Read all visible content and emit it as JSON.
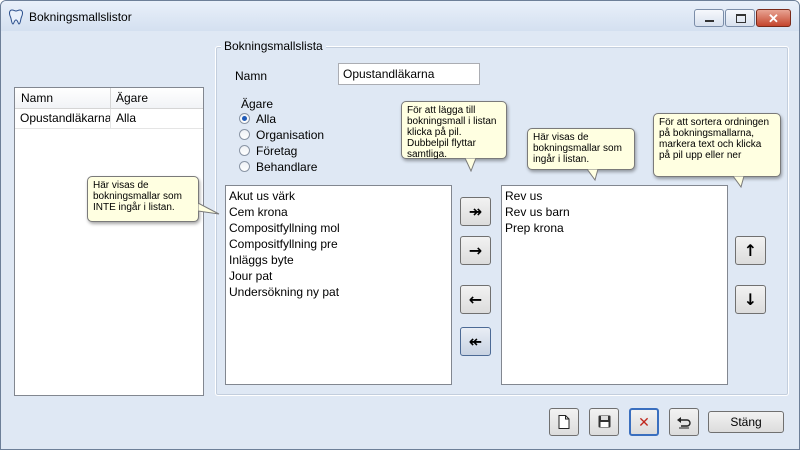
{
  "window": {
    "title": "Bokningsmallslistor",
    "icon": "tooth-icon",
    "controls": {
      "minimize": "minimize-icon",
      "maximize": "maximize-icon",
      "close": "✕"
    }
  },
  "grid": {
    "columns": [
      "Namn",
      "Ägare"
    ],
    "rows": [
      {
        "name": "Opustandläkarna",
        "owner": "Alla"
      }
    ]
  },
  "group": {
    "title": "Bokningsmallslista",
    "name_label": "Namn",
    "name_value": "Opustandläkarna",
    "owner_title": "Ägare",
    "owner_options": [
      "Alla",
      "Organisation",
      "Företag",
      "Behandlare"
    ],
    "owner_selected": "Alla"
  },
  "lists": {
    "available": [
      "Akut us värk",
      "Cem krona",
      "Compositfyllning mol",
      "Compositfyllning pre",
      "Inläggs byte",
      "Jour pat",
      "Undersökning ny pat"
    ],
    "included": [
      "Rev us",
      "Rev us barn",
      "Prep krona"
    ]
  },
  "buttons": {
    "add_all": "↠",
    "add": "→",
    "remove": "←",
    "remove_all": "↞",
    "up": "↑",
    "down": "↓",
    "new": "new-document-icon",
    "save": "save-icon",
    "delete": "✕",
    "undo": "undo-icon",
    "close_label": "Stäng"
  },
  "tooltips": {
    "not_included": "Här visas de bokningsmallar som INTE ingår i listan.",
    "add_help": "För att lägga till bokningsmall i listan klicka på pil. Dubbelpil flyttar samtliga.",
    "included_help": "Här visas de bokningsmallar som ingår i listan.",
    "sort_help": "För att sortera ordningen på bokningsmallarna, markera text och klicka på pil upp eller ner"
  }
}
